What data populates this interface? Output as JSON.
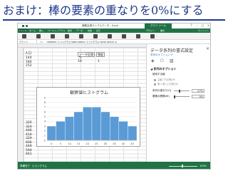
{
  "slide": {
    "title": "おまけ：棒の要素の重なりを0%にする"
  },
  "window": {
    "title": "講義会場サンプルデータ - Excel",
    "tool_tab": "グラフ ツール",
    "sign_in": "サインイン"
  },
  "ribbon": {
    "file_tab": "ファイル",
    "labels": [
      "ホーム",
      "挿入",
      "ページ レイアウト",
      "数式",
      "データ",
      "校閲",
      "表示",
      "デザイン",
      "書式"
    ]
  },
  "formula_bar": {
    "name_box": "グラフ 1",
    "fx": "fx",
    "text": "=SERIES(,'ヒストグラム'!$B$3:$B$12,'ヒストグラム'!$D$3:$D$12,1)"
  },
  "sheet": {
    "cell_label": "人口",
    "column_values": [
      "144",
      "184",
      "152",
      "320",
      "324",
      "406",
      "410",
      "329",
      "606",
      "449",
      "594",
      "641"
    ],
    "table_headers": [
      "データ区間",
      "頻度"
    ],
    "table_values": [
      "5",
      "10",
      "1"
    ]
  },
  "chart_data": {
    "type": "bar",
    "title": "観察値ヒストグラム",
    "categories": [
      "0",
      "5",
      "10",
      "15",
      "20",
      "25",
      "30",
      "35",
      "40",
      "45"
    ],
    "values": [
      3,
      4,
      5,
      6,
      7,
      7,
      6,
      5,
      4,
      3
    ],
    "ylim": [
      0,
      9
    ],
    "yticks": [
      "0",
      "1",
      "2",
      "3",
      "4",
      "5",
      "6",
      "7",
      "8",
      "9"
    ],
    "bar_color": "#5b9bd5",
    "gap_width": "0%"
  },
  "pane": {
    "title": "データ系列の書式設定",
    "close": "×",
    "subtitle": "系列のオプション ▾",
    "section": "◢ 系列のオプション",
    "axis_label": "使用する軸",
    "radio_primary": "主軸 (下/左側)(P)",
    "radio_secondary": "第 2 軸 (上/右側)(S)",
    "overlap_label": "系列の重なり(O)",
    "overlap_value": "-27%",
    "gap_label": "要素の間隔(W)",
    "gap_value": "0%"
  },
  "statusbar": {
    "ready": "準備完了",
    "sheet_tab": "ヒストグラム",
    "zoom": "100%"
  },
  "colors": {
    "excel_green": "#217346",
    "title_blue": "#1f3a8a",
    "bar_blue": "#5b9bd5"
  }
}
